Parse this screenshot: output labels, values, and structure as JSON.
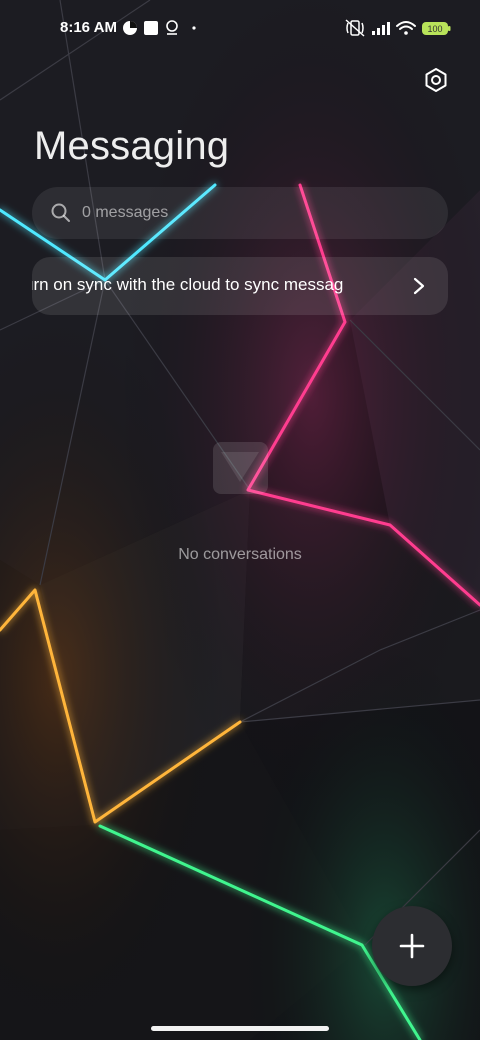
{
  "status_bar": {
    "time": "8:16 AM",
    "left_icons": [
      "app-notification-icon",
      "square-notification-icon",
      "location-pin-icon",
      "dot-icon"
    ],
    "right_icons": [
      "vibrate-muted-icon",
      "signal-icon",
      "wifi-icon",
      "battery-icon"
    ],
    "battery_label": "100"
  },
  "header": {
    "title": "Messaging",
    "settings_icon": "gear-icon"
  },
  "search": {
    "placeholder": "0 messages"
  },
  "sync_banner": {
    "text": "urn on sync with the cloud to sync messag"
  },
  "empty_state": {
    "text": "No conversations"
  },
  "fab": {
    "icon": "plus-icon"
  },
  "colors": {
    "background": "#0d0d10",
    "fab": "#2c2d31",
    "battery": "#b8e35a"
  }
}
